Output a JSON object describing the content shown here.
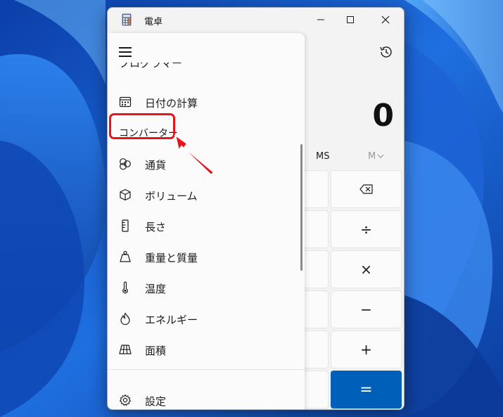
{
  "window": {
    "title": "電卓"
  },
  "display": {
    "value": "0"
  },
  "memory": {
    "ms": "MS",
    "mview": "M"
  },
  "keys": {
    "backspace": "⌫",
    "divide": "÷",
    "multiply": "×",
    "minus": "−",
    "plus": "+",
    "equals": "="
  },
  "nav": {
    "cut_item": "プログラマー",
    "date_calc": "日付の計算",
    "section": "コンバーター",
    "items": [
      {
        "label": "通貨",
        "icon": "currency-icon"
      },
      {
        "label": "ボリューム",
        "icon": "volume-cube-icon"
      },
      {
        "label": "長さ",
        "icon": "ruler-icon"
      },
      {
        "label": "重量と質量",
        "icon": "weight-icon"
      },
      {
        "label": "温度",
        "icon": "thermometer-icon"
      },
      {
        "label": "エネルギー",
        "icon": "flame-icon"
      },
      {
        "label": "面積",
        "icon": "area-grid-icon"
      }
    ],
    "settings": "設定"
  },
  "colors": {
    "accent": "#005fb8",
    "highlight": "#e8141b",
    "wallpaper": "#1b57c9"
  }
}
